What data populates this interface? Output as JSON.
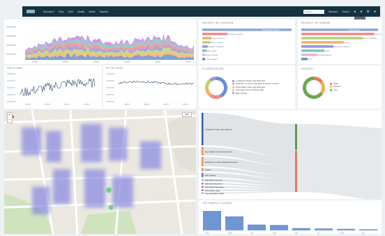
{
  "nav": {
    "menu": [
      "Security ▾",
      "Flow",
      "DNS",
      "Health",
      "Alerts",
      "Reports"
    ],
    "search_placeholder": "Search",
    "right_links": [
      "Sensors",
      "Tools ▾"
    ]
  },
  "panels": {
    "security_by_location": "SECURITY BY LOCATION",
    "security_by_vendor": "SECURITY BY VENDOR",
    "classification": "CLASSIFICATION",
    "severity": "SEVERITY",
    "top_flows": "TOP FLOWS",
    "rtt_by_host": "RTT BY HOST",
    "top_traffic_classes": "TOP TRAFFIC CLASSES"
  },
  "location_bars": [
    {
      "label": "Bumpersland, Sweden",
      "value": 1.0,
      "color": "#8fa8d8"
    },
    {
      "label": "Sandbyberg, Sweden",
      "value": 0.28,
      "color": "#f08b8b"
    },
    {
      "label": "Anyfor, Antarctica",
      "value": 0.1,
      "color": "#f7b16a"
    },
    {
      "label": "Munich, Germany",
      "value": 0.09,
      "color": "#b8d66f"
    },
    {
      "label": "Singapore, Singapore",
      "value": 0.06,
      "color": "#9e93d6"
    },
    {
      "label": "Tokyo, Japan",
      "value": 0.05,
      "color": "#7fc7c2"
    },
    {
      "label": "Sydney, Australia",
      "value": 0.03,
      "color": "#e5b7d6"
    },
    {
      "label": "London, England",
      "value": 0.03,
      "color": "#6a8fd1"
    }
  ],
  "vendor_bars": [
    {
      "label": "Cisco Systems",
      "value": 1.0,
      "color": "#8fa8d8"
    },
    {
      "label": "Juniper Networks",
      "value": 0.95,
      "color": "#f08b8b"
    },
    {
      "label": "Palo Alto Networks",
      "value": 0.8,
      "color": "#b8d66f"
    },
    {
      "label": "Fortinet",
      "value": 0.55,
      "color": "#f7b16a"
    },
    {
      "label": "Check Point Software",
      "value": 0.42,
      "color": "#9e93d6"
    },
    {
      "label": "Sophos",
      "value": 0.3,
      "color": "#7fc7c2"
    },
    {
      "label": "Barracuda Networks",
      "value": 0.2,
      "color": "#e5b7d6"
    },
    {
      "label": "Other",
      "value": 0.08,
      "color": "#6a8fd1"
    }
  ],
  "classification_legend": [
    {
      "label": "A Network Trojan was Detected",
      "color": "#6a8fd1"
    },
    {
      "label": "Detection of a Non-Standard Protocol or Event",
      "color": "#f08b8b"
    },
    {
      "label": "Executable Code was Detected",
      "color": "#f7b16a"
    },
    {
      "label": "Attempted User Privilege Gain",
      "color": "#b8d66f"
    },
    {
      "label": "Misc activity",
      "color": "#9e93d6"
    }
  ],
  "classification_slices": [
    0.42,
    0.18,
    0.16,
    0.14,
    0.1
  ],
  "severity_legend": [
    {
      "label": "High",
      "color": "#e77b5c"
    },
    {
      "label": "Medium",
      "color": "#f0b04a"
    },
    {
      "label": "Low",
      "color": "#6aa84f"
    }
  ],
  "severity_slices": [
    0.15,
    0.2,
    0.65
  ],
  "sankey_left": [
    {
      "label": "A Network Trojan was detected",
      "color": "#2b5ea8",
      "value": 0.38
    },
    {
      "label": "Executable Code was detected",
      "color": "#e8935a",
      "value": 0.1
    },
    {
      "label": "Detection of a Non-Standard Protocol",
      "color": "#e8935a",
      "value": 0.11
    },
    {
      "label": "Others",
      "color": "#e8935a",
      "value": 0.04
    },
    {
      "label": "Misc activity",
      "color": "#5f7fc2",
      "value": 0.05
    },
    {
      "label": "Attempted User Priv",
      "color": "#a7c1dd",
      "value": 0.03
    },
    {
      "label": "Attempted Denial of",
      "color": "#8b6bb0",
      "value": 0.02
    },
    {
      "label": "Attempted Information",
      "color": "#8b6bb0",
      "value": 0.02
    },
    {
      "label": "Information Leak",
      "color": "#8b6bb0",
      "value": 0.02
    },
    {
      "label": "Potentially Bad Traffic",
      "color": "#8b6bb0",
      "value": 0.01
    }
  ],
  "traffic_bars": [
    {
      "label": "http",
      "value": 1.0
    },
    {
      "label": "https",
      "value": 0.72
    },
    {
      "label": "dns",
      "value": 0.3
    },
    {
      "label": "smtp",
      "value": 0.28
    },
    {
      "label": "ssh",
      "value": 0.12
    },
    {
      "label": "ftp",
      "value": 0.1
    },
    {
      "label": "snmp",
      "value": 0.08
    },
    {
      "label": "ntp",
      "value": 0.06
    }
  ],
  "map": {
    "map_type_label": "Map",
    "zoom_in": "+",
    "zoom_out": "−"
  },
  "colors": {
    "nav_bg": "#16313f",
    "area_series": [
      "#6a8fd1",
      "#f7b16a",
      "#b8d66f",
      "#9e93d6",
      "#f08b8b",
      "#7fc7c2",
      "#c58ae0"
    ]
  },
  "icons": [
    "bell-icon",
    "chat-icon",
    "gear-icon",
    "user-icon"
  ]
}
